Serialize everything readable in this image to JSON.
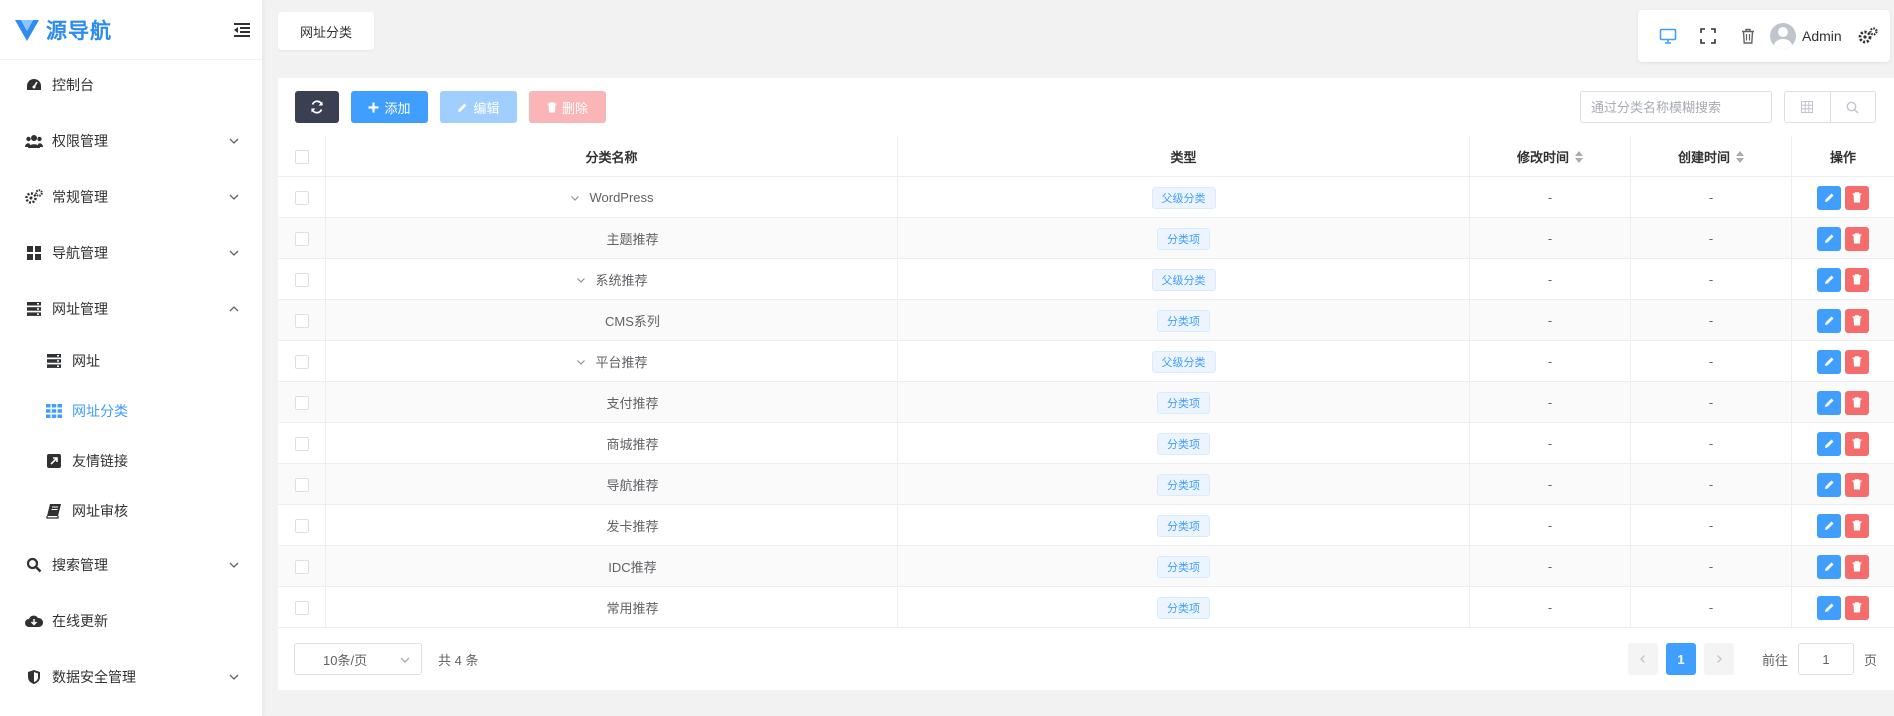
{
  "app": {
    "title": "源导航"
  },
  "sidebar": {
    "items": [
      {
        "label": "控制台",
        "icon": "dashboard-icon"
      },
      {
        "label": "权限管理",
        "icon": "users-icon"
      },
      {
        "label": "常规管理",
        "icon": "gears-icon"
      },
      {
        "label": "导航管理",
        "icon": "grid-icon"
      },
      {
        "label": "网址管理",
        "icon": "server-icon"
      },
      {
        "label": "网址",
        "icon": "server-icon"
      },
      {
        "label": "网址分类",
        "icon": "grid-dots-icon"
      },
      {
        "label": "友情链接",
        "icon": "external-link-icon"
      },
      {
        "label": "网址审核",
        "icon": "book-icon"
      },
      {
        "label": "搜索管理",
        "icon": "search-icon"
      },
      {
        "label": "在线更新",
        "icon": "cloud-download-icon"
      },
      {
        "label": "数据安全管理",
        "icon": "shield-icon"
      }
    ]
  },
  "header": {
    "tab": "网址分类",
    "user": "Admin"
  },
  "toolbar": {
    "add_label": "添加",
    "edit_label": "编辑",
    "delete_label": "删除",
    "search_placeholder": "通过分类名称模糊搜索"
  },
  "table": {
    "columns": {
      "name": "分类名称",
      "type": "类型",
      "modified": "修改时间",
      "created": "创建时间",
      "actions": "操作"
    },
    "rows": [
      {
        "name": "WordPress",
        "type": "父级分类",
        "modified": "-",
        "created": "-"
      },
      {
        "name": "主题推荐",
        "type": "分类项",
        "modified": "-",
        "created": "-"
      },
      {
        "name": "系统推荐",
        "type": "父级分类",
        "modified": "-",
        "created": "-"
      },
      {
        "name": "CMS系列",
        "type": "分类项",
        "modified": "-",
        "created": "-"
      },
      {
        "name": "平台推荐",
        "type": "父级分类",
        "modified": "-",
        "created": "-"
      },
      {
        "name": "支付推荐",
        "type": "分类项",
        "modified": "-",
        "created": "-"
      },
      {
        "name": "商城推荐",
        "type": "分类项",
        "modified": "-",
        "created": "-"
      },
      {
        "name": "导航推荐",
        "type": "分类项",
        "modified": "-",
        "created": "-"
      },
      {
        "name": "发卡推荐",
        "type": "分类项",
        "modified": "-",
        "created": "-"
      },
      {
        "name": "IDC推荐",
        "type": "分类项",
        "modified": "-",
        "created": "-"
      },
      {
        "name": "常用推荐",
        "type": "分类项",
        "modified": "-",
        "created": "-"
      }
    ]
  },
  "pagination": {
    "page_size": "10条/页",
    "total": "共 4 条",
    "current_page": "1",
    "goto_prefix": "前往",
    "goto_value": "1",
    "goto_suffix": "页"
  },
  "colors": {
    "accent": "#409eff",
    "danger": "#f56c6c",
    "dark_button": "#3a4052"
  }
}
